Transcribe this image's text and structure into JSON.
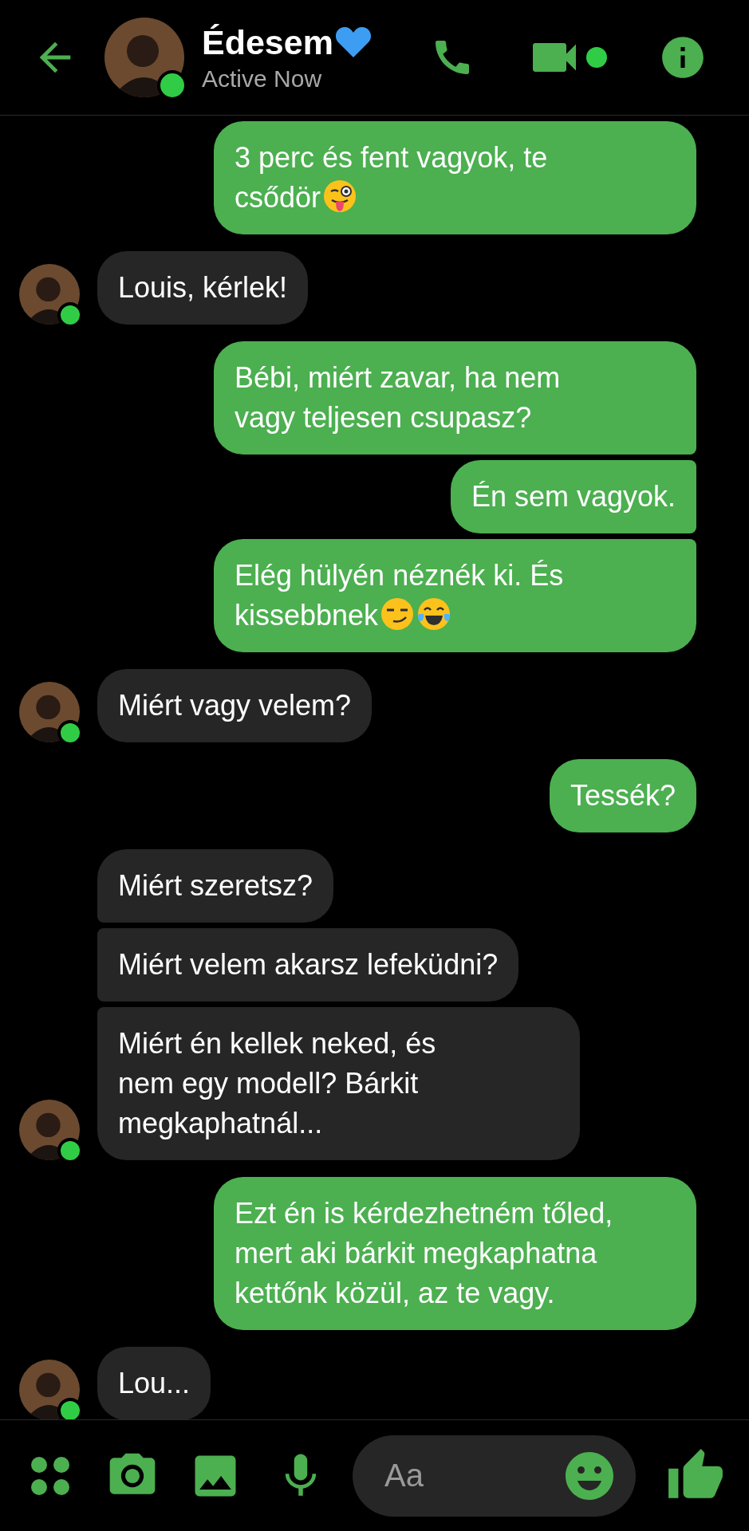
{
  "header": {
    "title": "Édesem",
    "title_emoji": {
      "kind": "blue-heart"
    },
    "status": "Active Now",
    "online": true
  },
  "messages": [
    {
      "kind": "outgoing",
      "lines": [
        "3 perc és fent vagyok, te",
        "csődör"
      ],
      "emojis": [
        {
          "kind": "tongue-wink"
        }
      ]
    },
    {
      "kind": "incoming",
      "lines": [
        "Louis, kérlek!"
      ],
      "avatar": true
    },
    {
      "kind": "outgoing",
      "lines": [
        "Bébi, miért zavar, ha nem",
        "vagy teljesen csupasz?"
      ]
    },
    {
      "kind": "outgoing",
      "lines": [
        "Én sem vagyok."
      ]
    },
    {
      "kind": "outgoing",
      "lines": [
        "Elég hülyén néznék ki. És",
        "kissebbnek"
      ],
      "emojis": [
        {
          "kind": "smirk"
        },
        {
          "kind": "tears-of-joy"
        }
      ]
    },
    {
      "kind": "incoming",
      "lines": [
        "Miért vagy velem?"
      ],
      "avatar": true
    },
    {
      "kind": "outgoing",
      "lines": [
        "Tessék?"
      ]
    },
    {
      "kind": "incoming",
      "lines": [
        "Miért szeretsz?"
      ],
      "avatar": false
    },
    {
      "kind": "incoming",
      "lines": [
        "Miért velem akarsz lefeküdni?"
      ],
      "avatar": false
    },
    {
      "kind": "incoming",
      "lines": [
        "Miért én kellek neked, és",
        "nem egy modell? Bárkit",
        "megkaphatnál..."
      ],
      "avatar": true
    },
    {
      "kind": "outgoing",
      "lines": [
        "Ezt én is kérdezhetném tőled,",
        "mert aki bárkit megkaphatna",
        "kettőnk közül, az te vagy."
      ]
    },
    {
      "kind": "incoming",
      "lines": [
        "Lou..."
      ],
      "avatar": true
    }
  ],
  "composer": {
    "placeholder": "Aa"
  }
}
